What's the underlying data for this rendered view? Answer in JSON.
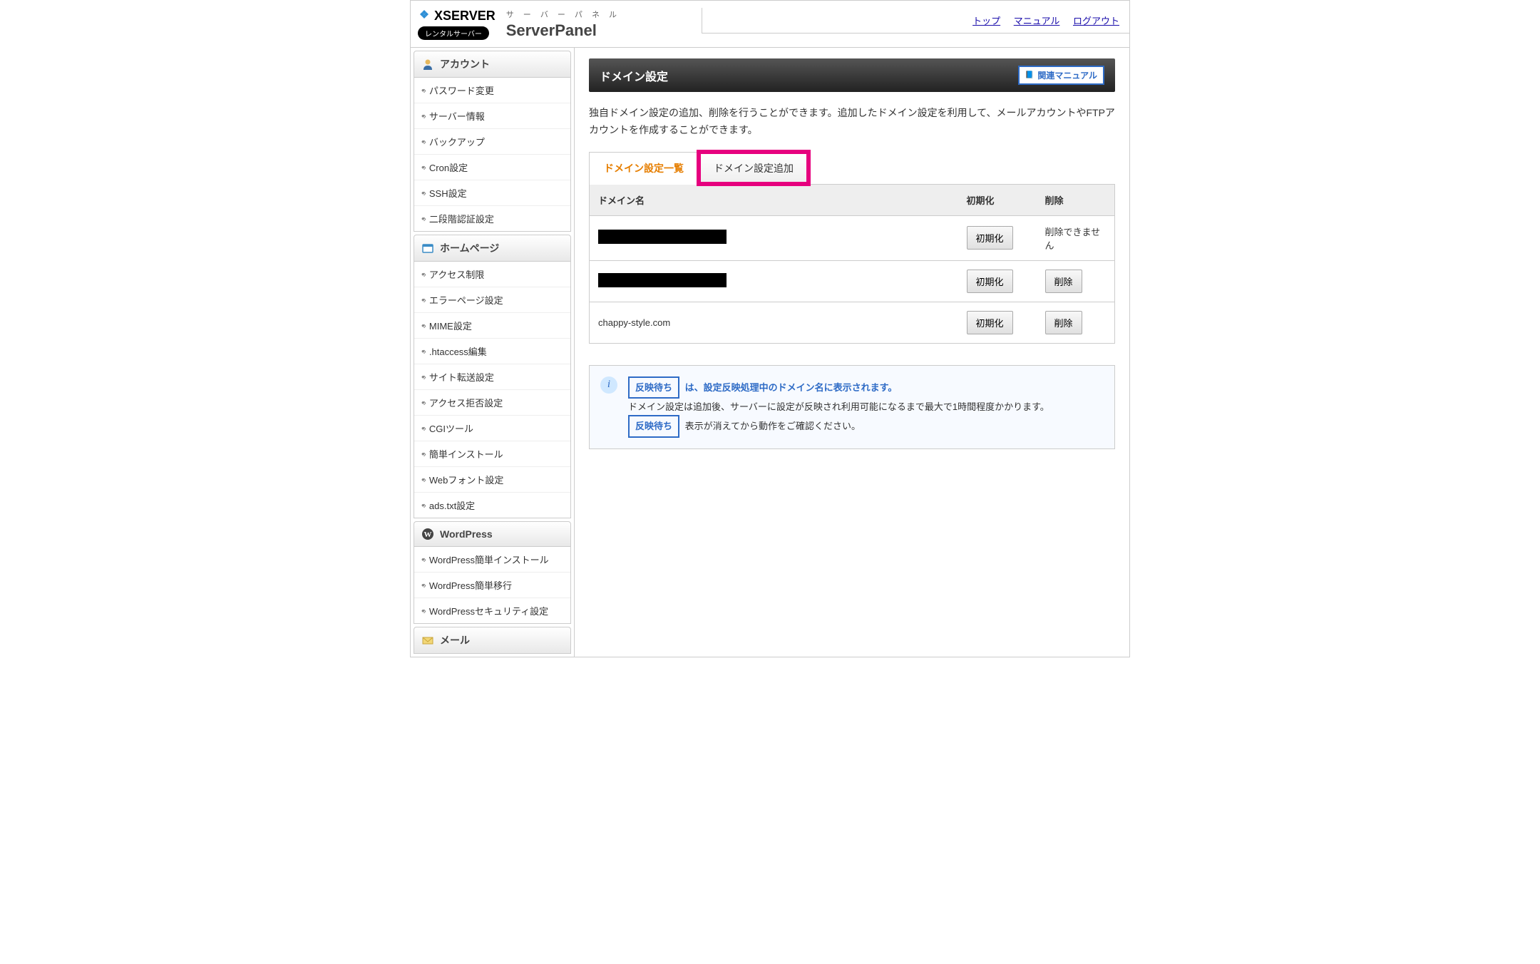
{
  "header": {
    "brand": "XSERVER",
    "rental_badge": "レンタルサーバー",
    "panel_small": "サ ー バ ー パ ネ ル",
    "panel_big": "ServerPanel"
  },
  "top_links": {
    "top": "トップ",
    "manual": "マニュアル",
    "logout": "ログアウト"
  },
  "sidebar": {
    "sections": [
      {
        "title": "アカウント",
        "icon": "person-icon",
        "items": [
          "パスワード変更",
          "サーバー情報",
          "バックアップ",
          "Cron設定",
          "SSH設定",
          "二段階認証設定"
        ]
      },
      {
        "title": "ホームページ",
        "icon": "window-icon",
        "items": [
          "アクセス制限",
          "エラーページ設定",
          "MIME設定",
          ".htaccess編集",
          "サイト転送設定",
          "アクセス拒否設定",
          "CGIツール",
          "簡単インストール",
          "Webフォント設定",
          "ads.txt設定"
        ]
      },
      {
        "title": "WordPress",
        "icon": "wordpress-icon",
        "items": [
          "WordPress簡単インストール",
          "WordPress簡単移行",
          "WordPressセキュリティ設定"
        ]
      },
      {
        "title": "メール",
        "icon": "mail-icon",
        "items": []
      }
    ]
  },
  "page": {
    "title": "ドメイン設定",
    "manual_button": "関連マニュアル",
    "description": "独自ドメイン設定の追加、削除を行うことができます。追加したドメイン設定を利用して、メールアカウントやFTPアカウントを作成することができます。",
    "tabs": {
      "list": "ドメイン設定一覧",
      "add": "ドメイン設定追加"
    },
    "table": {
      "headers": {
        "domain": "ドメイン名",
        "init": "初期化",
        "delete": "削除"
      },
      "rows": [
        {
          "domain": "[redacted]",
          "domain_redacted": true,
          "init_btn": "初期化",
          "delete_text": "削除できません",
          "delete_is_text": true
        },
        {
          "domain": "[redacted]",
          "domain_redacted": true,
          "init_btn": "初期化",
          "delete_btn": "削除",
          "delete_is_text": false
        },
        {
          "domain": "chappy-style.com",
          "domain_redacted": false,
          "init_btn": "初期化",
          "delete_btn": "削除",
          "delete_is_text": false
        }
      ]
    },
    "info": {
      "wait_badge": "反映待ち",
      "title_text": "は、設定反映処理中のドメイン名に表示されます。",
      "line1": "ドメイン設定は追加後、サーバーに設定が反映され利用可能になるまで最大で1時間程度かかります。",
      "line2": "表示が消えてから動作をご確認ください。"
    }
  }
}
